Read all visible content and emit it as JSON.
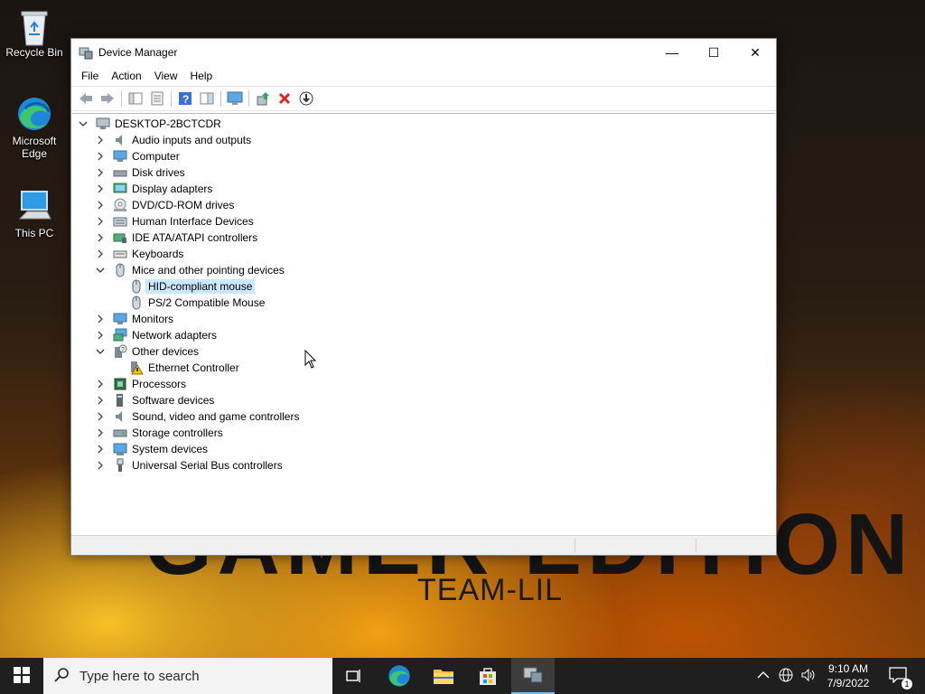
{
  "desktop": {
    "icons": [
      {
        "label": "Recycle Bin",
        "icon": "recycle-bin-icon"
      },
      {
        "label": "Microsoft Edge",
        "icon": "edge-icon"
      },
      {
        "label": "This PC",
        "icon": "this-pc-icon"
      }
    ],
    "wallpaper": {
      "big_text": "GAMER EDITION",
      "team_text": "TEAM-LIL"
    }
  },
  "window": {
    "title": "Device Manager",
    "controls": {
      "minimize": "—",
      "maximize": "☐",
      "close": "✕"
    },
    "menu": [
      "File",
      "Action",
      "View",
      "Help"
    ],
    "toolbar": [
      "back-icon",
      "forward-icon",
      "show-hide-console-tree-icon",
      "properties-icon",
      "help-icon",
      "action-pane-icon",
      "scan-hardware-icon",
      "update-driver-icon",
      "uninstall-icon",
      "disable-device-icon"
    ]
  },
  "tree": {
    "root": "DESKTOP-2BCTCDR",
    "items": [
      {
        "label": "Audio inputs and outputs",
        "expanded": false
      },
      {
        "label": "Computer",
        "expanded": false
      },
      {
        "label": "Disk drives",
        "expanded": false
      },
      {
        "label": "Display adapters",
        "expanded": false
      },
      {
        "label": "DVD/CD-ROM drives",
        "expanded": false
      },
      {
        "label": "Human Interface Devices",
        "expanded": false
      },
      {
        "label": "IDE ATA/ATAPI controllers",
        "expanded": false
      },
      {
        "label": "Keyboards",
        "expanded": false
      },
      {
        "label": "Mice and other pointing devices",
        "expanded": true,
        "children": [
          "HID-compliant mouse",
          "PS/2 Compatible Mouse"
        ],
        "selected_child": "HID-compliant mouse"
      },
      {
        "label": "Monitors",
        "expanded": false
      },
      {
        "label": "Network adapters",
        "expanded": false
      },
      {
        "label": "Other devices",
        "expanded": true,
        "children": [
          "Ethernet Controller"
        ]
      },
      {
        "label": "Processors",
        "expanded": false
      },
      {
        "label": "Software devices",
        "expanded": false
      },
      {
        "label": "Sound, video and game controllers",
        "expanded": false
      },
      {
        "label": "Storage controllers",
        "expanded": false
      },
      {
        "label": "System devices",
        "expanded": false
      },
      {
        "label": "Universal Serial Bus controllers",
        "expanded": false
      }
    ]
  },
  "taskbar": {
    "search_placeholder": "Type here to search",
    "apps": [
      "task-view-icon",
      "edge-icon",
      "file-explorer-icon",
      "microsoft-store-icon",
      "device-manager-icon"
    ],
    "active_app": "device-manager-icon",
    "clock": {
      "time": "9:10 AM",
      "date": "7/9/2022"
    },
    "notification_count": "1"
  },
  "colors": {
    "selection": "#cce8ff",
    "taskbar": "#1f1f1f",
    "accent": "#76b9ed"
  }
}
